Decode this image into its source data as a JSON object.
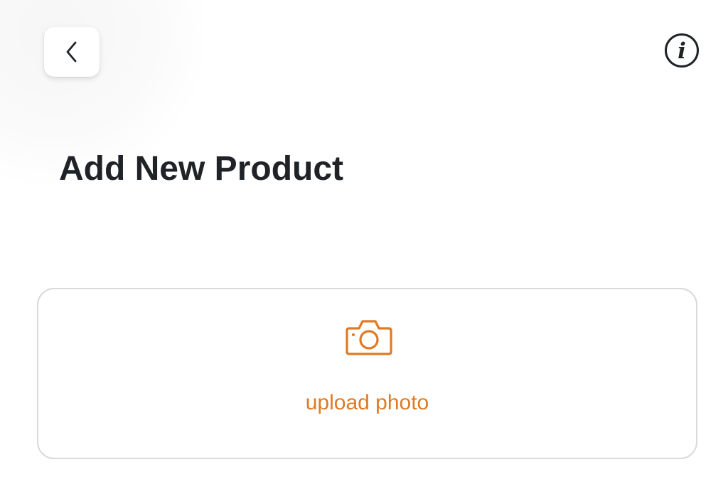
{
  "header": {
    "back_icon": "chevron-left-icon",
    "info_icon": "info-icon"
  },
  "page": {
    "title": "Add New Product"
  },
  "upload": {
    "icon": "camera-icon",
    "label": "upload photo"
  },
  "colors": {
    "accent": "#e07a22",
    "title": "#1f2328",
    "card_border": "#d9d9d9",
    "background": "#ffffff"
  }
}
